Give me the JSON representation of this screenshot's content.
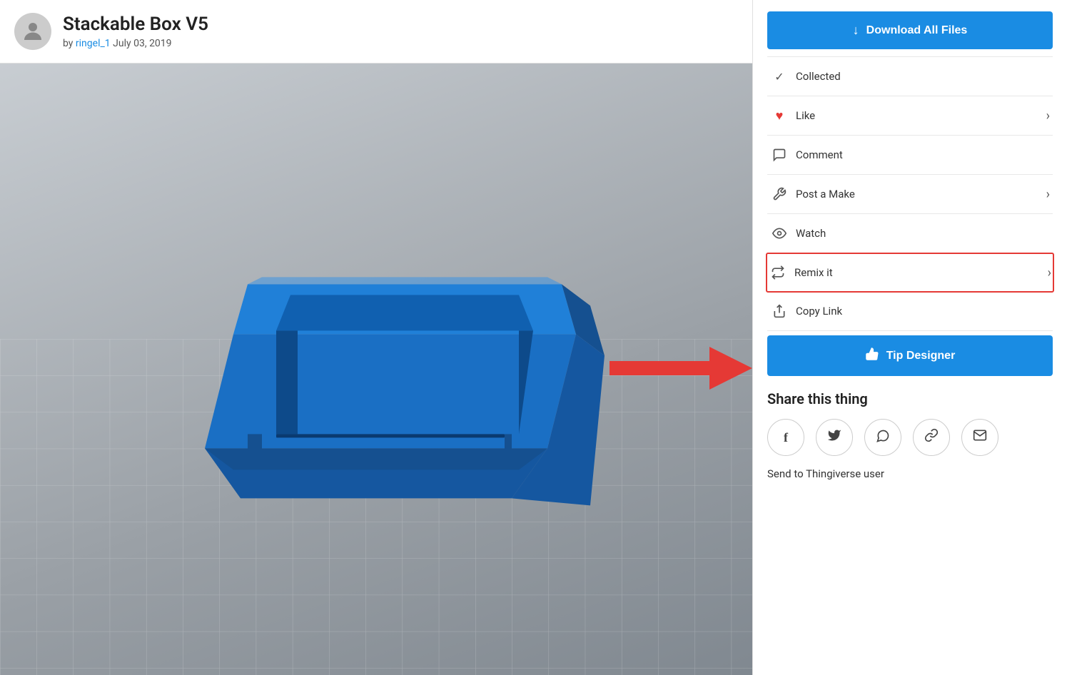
{
  "header": {
    "title": "Stackable Box V5",
    "by_label": "by",
    "author": "ringel_1",
    "date": "July 03, 2019"
  },
  "sidebar": {
    "download_label": "Download All Files",
    "collected_label": "Collected",
    "like_label": "Like",
    "comment_label": "Comment",
    "post_make_label": "Post a Make",
    "watch_label": "Watch",
    "remix_label": "Remix it",
    "copy_link_label": "Copy Link",
    "tip_label": "Tip Designer",
    "share_title": "Share this thing",
    "send_label": "Send to Thingiverse user"
  },
  "icons": {
    "download": "↓",
    "check": "✓",
    "heart": "♥",
    "comment": "💬",
    "post_make": "🔧",
    "watch": "👁",
    "remix": "🔁",
    "copy_link": "⬆",
    "tip": "👍",
    "facebook": "f",
    "twitter": "🐦",
    "whatsapp": "💬",
    "link": "🔗",
    "email": "✉"
  }
}
